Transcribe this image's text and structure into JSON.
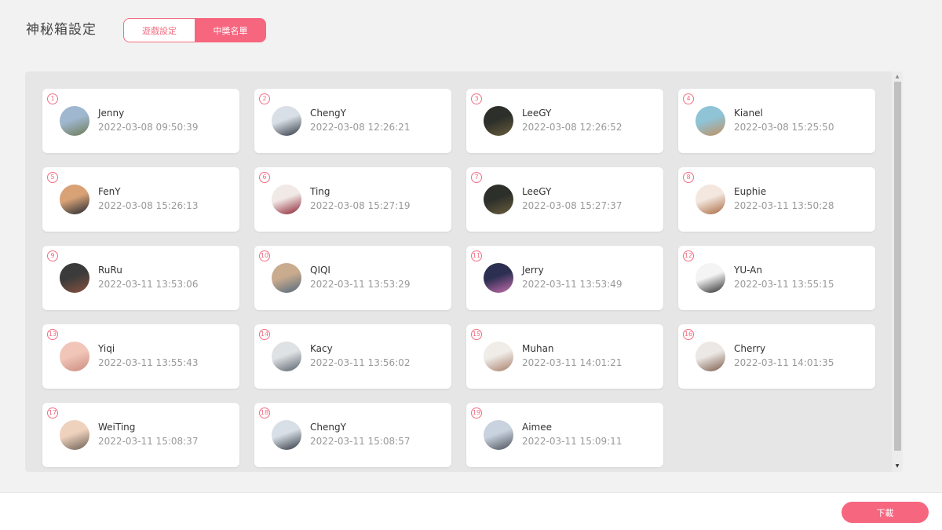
{
  "page": {
    "title": "神秘箱設定",
    "tabs": [
      {
        "label": "遊戲設定",
        "active": false
      },
      {
        "label": "中獎名單",
        "active": true
      }
    ]
  },
  "winners": [
    {
      "num": "1",
      "name": "Jenny",
      "time": "2022-03-08 09:50:39",
      "avatar_colors": [
        "#9fb7cf",
        "#6e7a55"
      ]
    },
    {
      "num": "2",
      "name": "ChengY",
      "time": "2022-03-08 12:26:21",
      "avatar_colors": [
        "#d9dfe6",
        "#2f3640"
      ]
    },
    {
      "num": "3",
      "name": "LeeGY",
      "time": "2022-03-08 12:26:52",
      "avatar_colors": [
        "#2c2f2a",
        "#6b5d3d"
      ]
    },
    {
      "num": "4",
      "name": "Kianel",
      "time": "2022-03-08 15:25:50",
      "avatar_colors": [
        "#8fc3d6",
        "#c08f5f"
      ]
    },
    {
      "num": "5",
      "name": "FenY",
      "time": "2022-03-08 15:26:13",
      "avatar_colors": [
        "#d8a276",
        "#1f2630"
      ]
    },
    {
      "num": "6",
      "name": "Ting",
      "time": "2022-03-08 15:27:19",
      "avatar_colors": [
        "#f1e9e6",
        "#8a1e2e"
      ]
    },
    {
      "num": "7",
      "name": "LeeGY",
      "time": "2022-03-08 15:27:37",
      "avatar_colors": [
        "#2c2f2a",
        "#6b5d3d"
      ]
    },
    {
      "num": "8",
      "name": "Euphie",
      "time": "2022-03-11 13:50:28",
      "avatar_colors": [
        "#f3e7df",
        "#a8683f"
      ]
    },
    {
      "num": "9",
      "name": "RuRu",
      "time": "2022-03-11 13:53:06",
      "avatar_colors": [
        "#3a3b3a",
        "#8a5240"
      ]
    },
    {
      "num": "10",
      "name": "QIQI",
      "time": "2022-03-11 13:53:29",
      "avatar_colors": [
        "#c9ab8e",
        "#52697d"
      ]
    },
    {
      "num": "11",
      "name": "Jerry",
      "time": "2022-03-11 13:53:49",
      "avatar_colors": [
        "#2d2f52",
        "#c86fae"
      ]
    },
    {
      "num": "12",
      "name": "YU-An",
      "time": "2022-03-11 13:55:15",
      "avatar_colors": [
        "#f4f4f4",
        "#2b2b2b"
      ]
    },
    {
      "num": "13",
      "name": "Yiqi",
      "time": "2022-03-11 13:55:43",
      "avatar_colors": [
        "#f1c6b9",
        "#c98b7f"
      ]
    },
    {
      "num": "14",
      "name": "Kacy",
      "time": "2022-03-11 13:56:02",
      "avatar_colors": [
        "#dfe2e4",
        "#56606a"
      ]
    },
    {
      "num": "15",
      "name": "Muhan",
      "time": "2022-03-11 14:01:21",
      "avatar_colors": [
        "#f0ece8",
        "#a77d68"
      ]
    },
    {
      "num": "16",
      "name": "Cherry",
      "time": "2022-03-11 14:01:35",
      "avatar_colors": [
        "#ece8e5",
        "#7c5a4a"
      ]
    },
    {
      "num": "17",
      "name": "WeiTing",
      "time": "2022-03-11 15:08:37",
      "avatar_colors": [
        "#efd2bd",
        "#6a5e55"
      ]
    },
    {
      "num": "18",
      "name": "ChengY",
      "time": "2022-03-11 15:08:57",
      "avatar_colors": [
        "#d9dfe6",
        "#2f3640"
      ]
    },
    {
      "num": "19",
      "name": "Aimee",
      "time": "2022-03-11 15:09:11",
      "avatar_colors": [
        "#c9d3df",
        "#4a4f57"
      ]
    }
  ],
  "footer": {
    "download_label": "下載"
  },
  "colors": {
    "accent": "#f7667f",
    "panel_bg": "#e6e6e6",
    "page_bg": "#f2f2f2"
  },
  "icons": {
    "scroll_up": "triangle-up",
    "scroll_down": "triangle-down"
  }
}
